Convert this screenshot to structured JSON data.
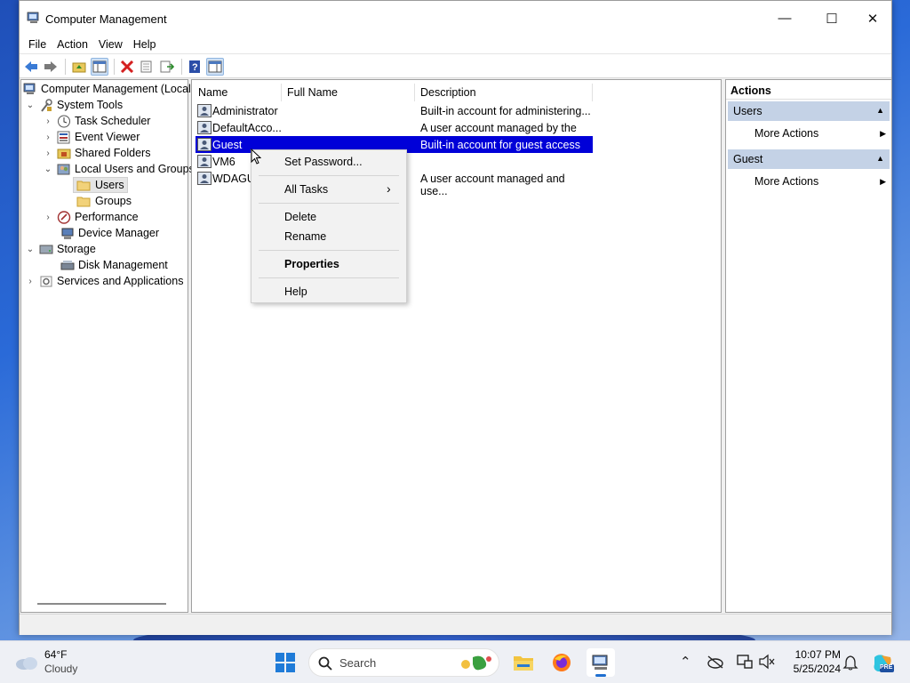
{
  "window": {
    "title": "Computer Management",
    "controls": {
      "minimize": "—",
      "maximize": "☐",
      "close": "✕"
    }
  },
  "menu": [
    "File",
    "Action",
    "View",
    "Help"
  ],
  "tree": {
    "root": "Computer Management (Local",
    "system_tools": "System Tools",
    "task_scheduler": "Task Scheduler",
    "event_viewer": "Event Viewer",
    "shared_folders": "Shared Folders",
    "local_users_groups": "Local Users and Groups",
    "users": "Users",
    "groups": "Groups",
    "performance": "Performance",
    "device_manager": "Device Manager",
    "storage": "Storage",
    "disk_management": "Disk Management",
    "services_apps": "Services and Applications"
  },
  "list": {
    "columns": [
      "Name",
      "Full Name",
      "Description"
    ],
    "rows": [
      {
        "name": "Administrator",
        "full_name": "",
        "description": "Built-in account for administering..."
      },
      {
        "name": "DefaultAcco...",
        "full_name": "",
        "description": "A user account managed by the s..."
      },
      {
        "name": "Guest",
        "full_name": "",
        "description": "Built-in account for guest access t..."
      },
      {
        "name": "VM6",
        "full_name": "",
        "description": ""
      },
      {
        "name": "WDAGU",
        "full_name": "",
        "description": "A user account managed and use..."
      }
    ]
  },
  "context_menu": {
    "set_password": "Set Password...",
    "all_tasks": "All Tasks",
    "delete": "Delete",
    "rename": "Rename",
    "properties": "Properties",
    "help": "Help"
  },
  "actions": {
    "header": "Actions",
    "section1": "Users",
    "section1_item": "More Actions",
    "section2": "Guest",
    "section2_item": "More Actions"
  },
  "taskbar": {
    "weather_temp": "64°F",
    "weather_desc": "Cloudy",
    "search_placeholder": "Search",
    "time": "10:07 PM",
    "date": "5/25/2024"
  },
  "colors": {
    "selection": "#0000d8",
    "actions_section": "#c4d2e6"
  }
}
